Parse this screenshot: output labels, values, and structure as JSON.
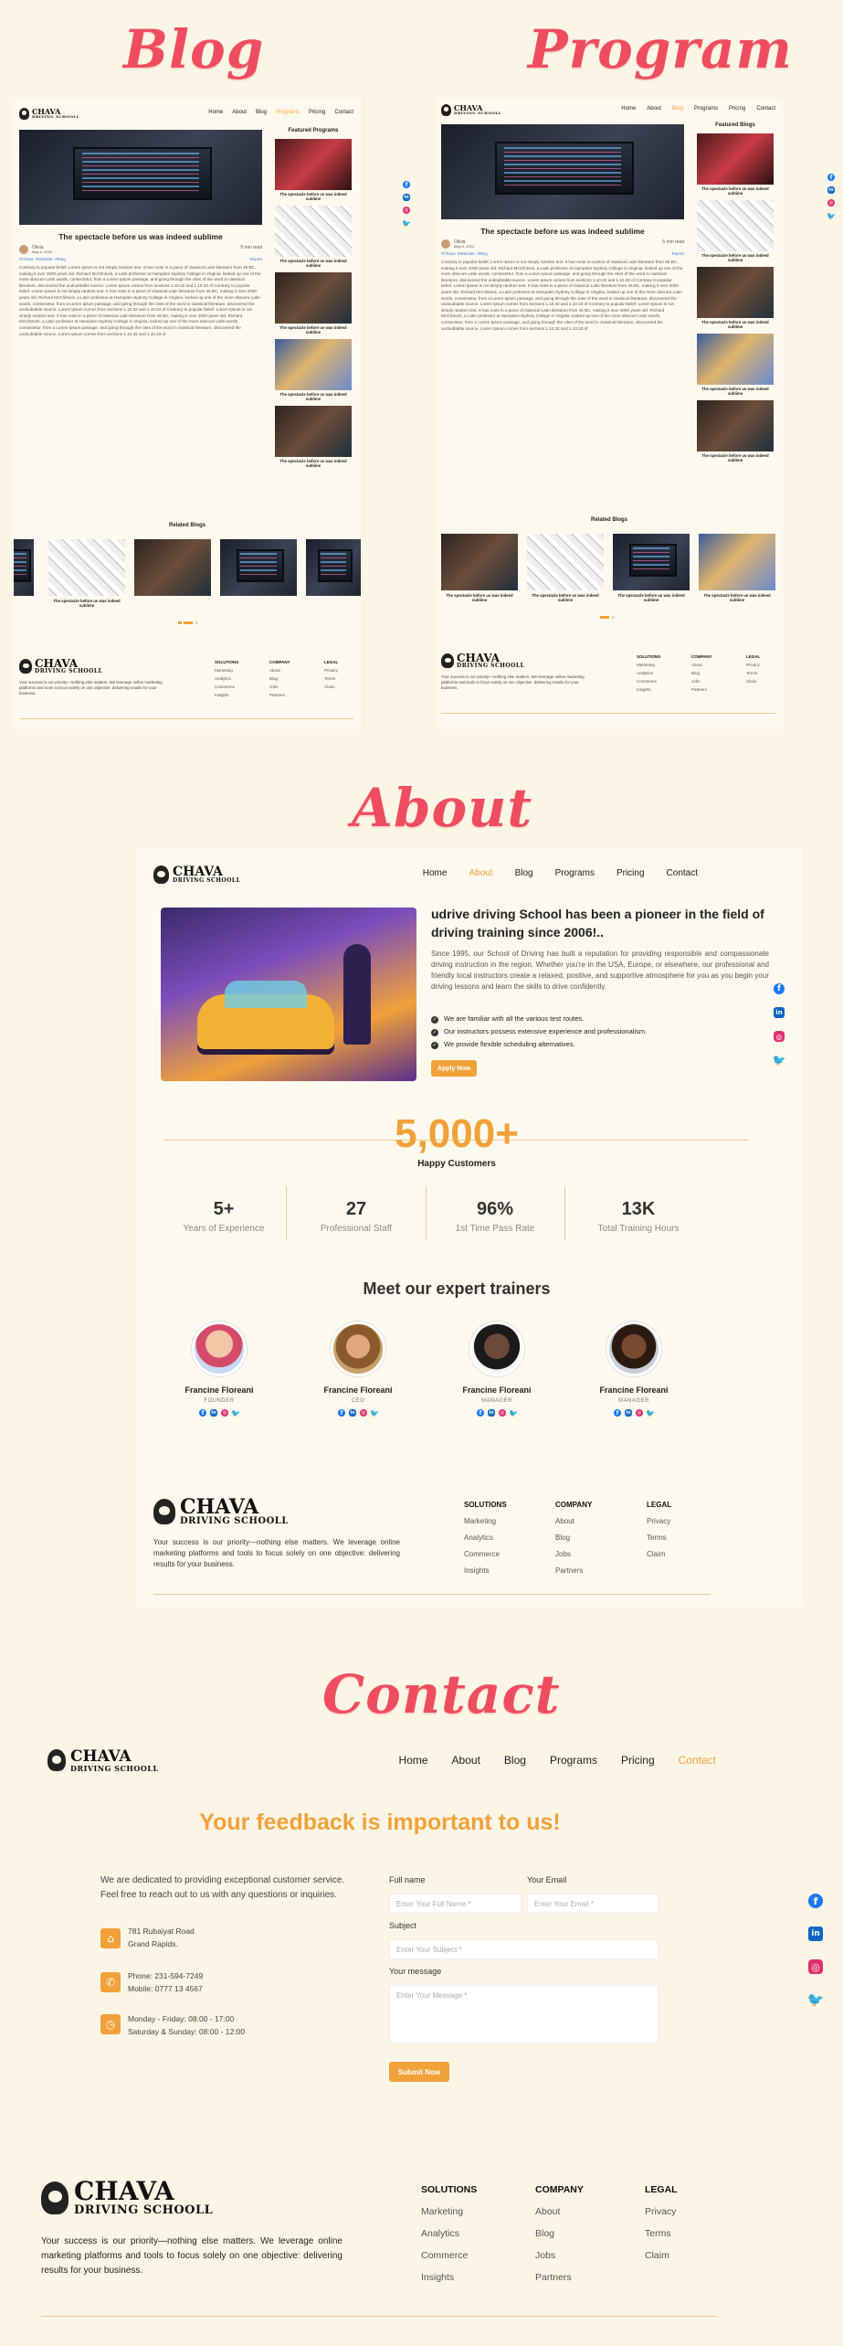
{
  "headings": {
    "blog": "Blog",
    "program": "Program",
    "about": "About",
    "contact": "Contact"
  },
  "nav": {
    "brand_big": "CHAVA",
    "brand_small": "DRIVING SCHOOLL",
    "items": [
      "Home",
      "About",
      "Blog",
      "Programs",
      "Pricing",
      "Contact"
    ]
  },
  "blog_page": {
    "title": "The spectacle before us was indeed sublime",
    "author": "Olivia",
    "date": "May 6, 2023",
    "read": "5 min read",
    "tags": [
      "#Chava",
      "#Website",
      "#Blog"
    ],
    "report": "Report",
    "body": "Contrary to popular belief, Lorem Ipsum is not simply random text. It has roots in a piece of classical Latin literature from 45 BC, making it over 2000 years old. Richard McClintock, a Latin professor at Hampden-Sydney College in Virginia, looked up one of the more obscure Latin words, consectetur, from a Lorem Ipsum passage, and going through the cites of the word in classical literature, discovered the undoubtable source. Lorem Ipsum comes from sections 1.10.32 and 1.10.33 of Contrary to popular belief. Lorem Ipsum is not simply random text. It has roots in a piece of classical Latin literature from 45 BC, making it over 2000 years old. Richard McClintock, a Latin professor at Hampden-Sydney College in Virginia, looked up one of the more obscure Latin words, consectetur, from a Lorem Ipsum passage, and going through the cites of the word in classical literature, discovered the undoubtable source. Lorem Ipsum comes from sections 1.10.32 and 1.10.33 of Contrary to popular belief. Lorem Ipsum is not simply random text. It has roots in a piece of classical Latin literature from 45 BC, making it over 2000 years old. Richard McClintock, a Latin professor at Hampden-Sydney College in Virginia, looked up one of the more obscure Latin words, consectetur, from a Lorem Ipsum passage, and going through the cites of the word in classical literature, discovered the undoubtable source. Lorem Ipsum comes from sections 1.10.32 and 1.10.33 of",
    "sidebar_title": "Featured Programs",
    "card_caption": "The spectacle before us was indeed sublime",
    "related_title": "Related Blogs"
  },
  "program_page": {
    "sidebar_title": "Featured Blogs",
    "related_title": "Related Blogs"
  },
  "about": {
    "headline": "udrive driving School has been a pioneer in the field of driving training since 2006!..",
    "desc": "Since 1995, our School of Driving has built a reputation for providing responsible and compassionate driving instruction in the region. Whether you're in the USA, Europe, or elsewhere, our professional and friendly local instructors create a relaxed, positive, and supportive atmosphere for you as you begin your driving lessons and learn the skills to drive confidently.",
    "checks": [
      "We are familiar with all the various test routes.",
      "Our instructors possess extensive experience and professionalism.",
      "We provide flexible scheduling alternatives."
    ],
    "button": "Apply Now",
    "big_number": "5,000+",
    "big_label": "Happy Customers",
    "stats": [
      {
        "n": "5+",
        "l": "Years of Experience"
      },
      {
        "n": "27",
        "l": "Professional Staff"
      },
      {
        "n": "96%",
        "l": "1st Time Pass Rate"
      },
      {
        "n": "13K",
        "l": "Total Training Hours"
      }
    ],
    "trainers_title": "Meet our expert trainers",
    "trainers": [
      {
        "name": "Francine Floreani",
        "role": "FOUNDER"
      },
      {
        "name": "Francine Floreani",
        "role": "CEO"
      },
      {
        "name": "Francine Floreani",
        "role": "MANAGER"
      },
      {
        "name": "Francine Floreani",
        "role": "MANAGER"
      }
    ]
  },
  "contact": {
    "headline": "Your feedback is important to us!",
    "intro": "We are dedicated to providing exceptional customer service. Feel free to reach out to us with any questions or inquiries.",
    "address1": "781 Rubaiyat Road",
    "address2": "Grand Rapids.",
    "phone": "Phone: 231-594-7249",
    "mobile": "Mobile: 0777 13 4567",
    "hours1": "Monday - Friday: 08:00 - 17:00",
    "hours2": "Saturday & Sunday: 08:00 - 12:00",
    "full_name_label": "Full name",
    "full_name_ph": "Enter Your Full Name *",
    "email_label": "Your Email",
    "email_ph": "Enter Your Email *",
    "subject_label": "Subject",
    "subject_ph": "Enter Your Subject *",
    "message_label": "Your message",
    "message_ph": "Enter Your Message *",
    "submit": "Submit Now"
  },
  "footer": {
    "tagline": "Your success is our priority—nothing else matters. We leverage online marketing platforms and tools to focus solely on one objective: delivering results for your business.",
    "cols": [
      {
        "h": "SOLUTIONS",
        "items": [
          "Marketing",
          "Analytics",
          "Commerce",
          "Insights"
        ]
      },
      {
        "h": "COMPANY",
        "items": [
          "About",
          "Blog",
          "Jobs",
          "Partners"
        ]
      },
      {
        "h": "LEGAL",
        "items": [
          "Privacy",
          "Terms",
          "Claim"
        ]
      }
    ]
  },
  "colors": {
    "accent": "#f0a13a",
    "title_red": "#ee4d5f",
    "bg": "#fbf5e6"
  }
}
